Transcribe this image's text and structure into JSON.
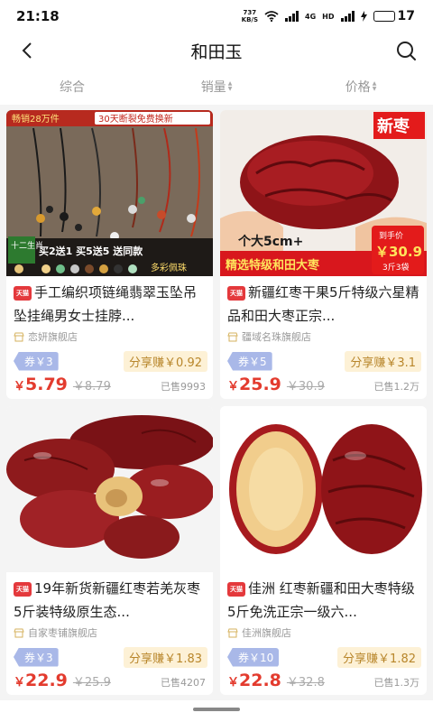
{
  "status_bar": {
    "time": "21:18",
    "net_speed_value": "737",
    "net_speed_unit": "KB/S",
    "signal_1_label": "4G",
    "signal_2_label": "HD",
    "battery_level": "17",
    "battery_fraction": 0.17
  },
  "nav": {
    "title": "和田玉",
    "back_icon": "chevron-left-icon",
    "search_icon": "search-icon"
  },
  "sort_tabs": [
    {
      "label": "综合"
    },
    {
      "label": "销量"
    },
    {
      "label": "价格"
    }
  ],
  "products": [
    {
      "mall_tag": "天猫",
      "title": "手工编织项链绳翡翠玉坠吊坠挂绳男女士挂脖...",
      "shop": "恋妍旗舰店",
      "coupon": "券￥3",
      "share": "分享赚￥0.92",
      "currency": "￥",
      "price": "5.79",
      "original_price": "￥8.79",
      "sold": "已售9993",
      "image_banner_left": "畅销28万件",
      "image_banner_right": "30天断裂免费换新",
      "image_side_label": "十二生肖",
      "image_bottom_text": "买2送1 买5送5 送同款",
      "image_bottom_sub": "多彩佩珠"
    },
    {
      "mall_tag": "天猫",
      "title": "新疆红枣干果5斤特级六星精品和田大枣正宗...",
      "shop": "疆域名珠旗舰店",
      "coupon": "券￥5",
      "share": "分享赚￥3.1",
      "currency": "￥",
      "price": "25.9",
      "original_price": "￥30.9",
      "sold": "已售1.2万",
      "image_corner_label": "新枣",
      "image_size_text": "个大5cm+",
      "image_bottom_text": "精选特级和田大枣",
      "image_price_label": "到手价",
      "image_price_value": "￥30.9",
      "image_price_sub": "3斤3袋"
    },
    {
      "mall_tag": "天猫",
      "title": "19年新货新疆红枣若羌灰枣5斤装特级原生态...",
      "shop": "自家枣铺旗舰店",
      "coupon": "券￥3",
      "share": "分享赚￥1.83",
      "currency": "￥",
      "price": "22.9",
      "original_price": "￥25.9",
      "sold": "已售4207"
    },
    {
      "mall_tag": "天猫",
      "title": "佳洲 红枣新疆和田大枣特级5斤免洗正宗一级六...",
      "shop": "佳洲旗舰店",
      "coupon": "券￥10",
      "share": "分享赚￥1.82",
      "currency": "￥",
      "price": "22.8",
      "original_price": "￥32.8",
      "sold": "已售1.3万"
    }
  ],
  "colors": {
    "price_red": "#e33b2e",
    "coupon_blue": "#a9b8e8",
    "share_bg": "#fdf1d6",
    "share_text": "#b8862b",
    "tmall_red": "#e4393c"
  }
}
